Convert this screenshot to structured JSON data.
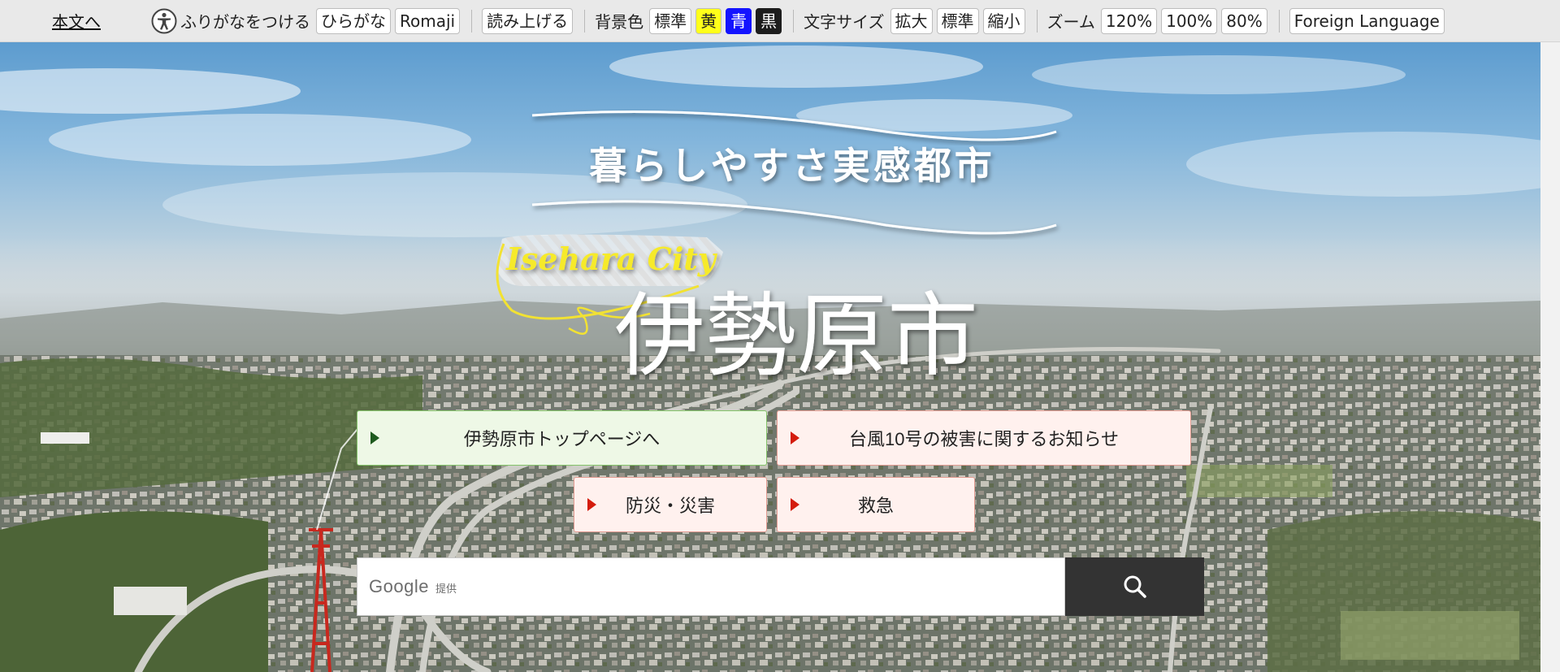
{
  "toolbar": {
    "skip_link": "本文へ",
    "furigana_label": "ふりがなをつける",
    "hiragana": "ひらがな",
    "romaji": "Romaji",
    "read_aloud": "読み上げる",
    "bg_color_label": "背景色",
    "bg_standard": "標準",
    "bg_yellow": "黄",
    "bg_blue": "青",
    "bg_black": "黒",
    "font_size_label": "文字サイズ",
    "font_enlarge": "拡大",
    "font_standard": "標準",
    "font_shrink": "縮小",
    "zoom_label": "ズーム",
    "zoom_120": "120%",
    "zoom_100": "100%",
    "zoom_80": "80%",
    "foreign_language": "Foreign Language",
    "colors": {
      "yellow": "#ffff1a",
      "blue": "#1414ff",
      "black": "#1d1d1d"
    }
  },
  "hero": {
    "catchphrase": "暮らしやすさ実感都市",
    "city_name_en": "Isehara City",
    "city_name": "伊勢原市"
  },
  "links": {
    "top_page": "伊勢原市トップページへ",
    "typhoon_notice": "台風10号の被害に関するお知らせ",
    "disaster": "防災・災害",
    "emergency": "救急"
  },
  "search": {
    "brand": "Google",
    "provided": "提供",
    "button_icon": "search-icon"
  }
}
